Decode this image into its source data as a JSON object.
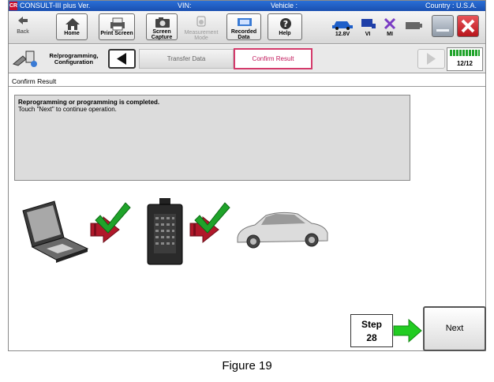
{
  "titlebar": {
    "logo": "CR",
    "app": "CONSULT-III plus  Ver.",
    "vin": "VIN:",
    "vehicle": "Vehicle :",
    "country": "Country : U.S.A."
  },
  "toolbar": {
    "back": "Back",
    "home": "Home",
    "print_screen": "Print Screen",
    "screen_capture": "Screen Capture",
    "measurement_mode": "Measurement Mode",
    "recorded_data": "Recorded Data",
    "help": "Help",
    "voltage": "12.8V",
    "vi": "VI",
    "mi": "MI"
  },
  "stepbar": {
    "section": "Re/programming, Configuration",
    "crumb_transfer": "Transfer Data",
    "crumb_confirm": "Confirm Result",
    "progress": "12/12"
  },
  "page": {
    "title": "Confirm Result",
    "message_line1": "Reprogramming or programming is completed.",
    "message_line2": "Touch \"Next\" to continue operation."
  },
  "actions": {
    "step_label": "Step",
    "step_number": "28",
    "next": "Next"
  },
  "caption": "Figure 19",
  "colors": {
    "titlebar": "#1a4fb0",
    "confirm_crumb": "#d43a6b",
    "check_green": "#1fa32a",
    "arrow_red": "#b0182a",
    "close_red": "#d9262d",
    "step_arrow": "#22cc22"
  }
}
